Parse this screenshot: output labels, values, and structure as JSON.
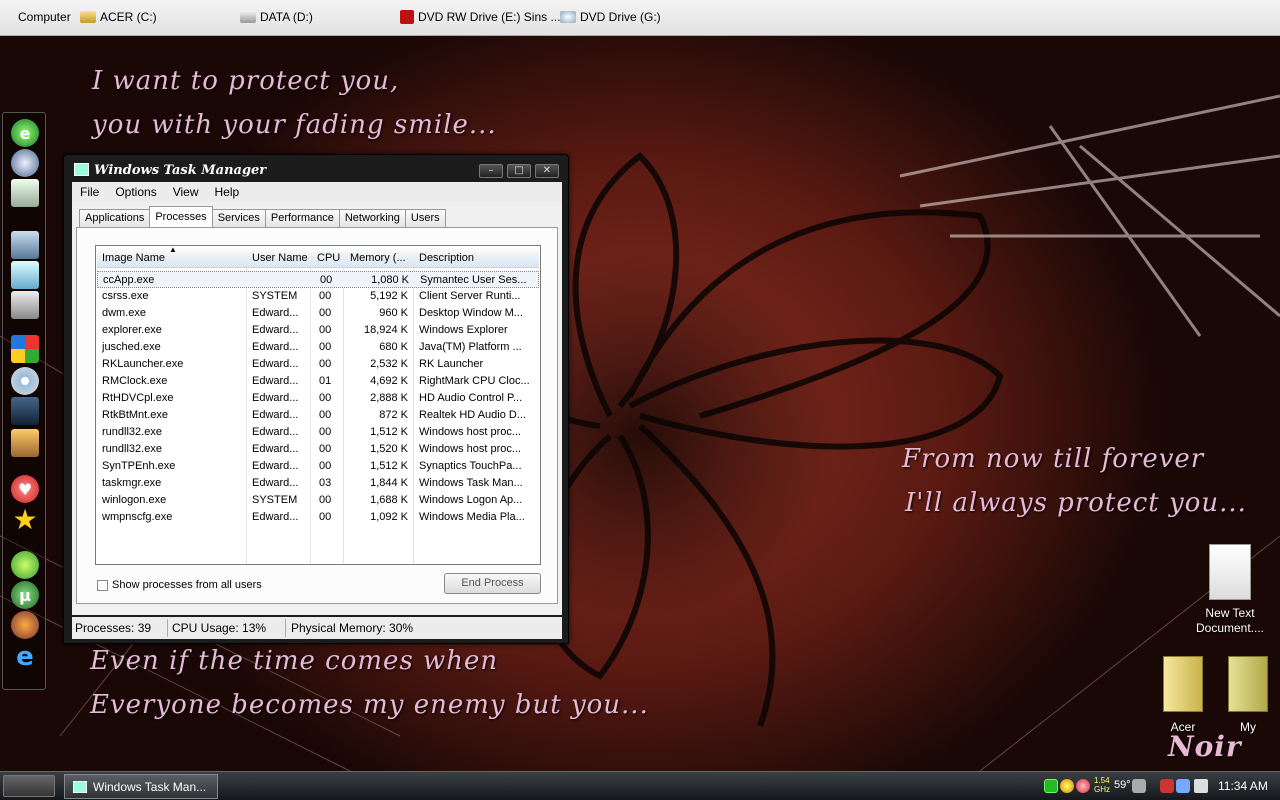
{
  "drives_bar": {
    "items": [
      {
        "label": "Computer",
        "icon": "computer-icon"
      },
      {
        "label": "ACER (C:)",
        "icon": "hard-drive-icon"
      },
      {
        "label": "DATA (D:)",
        "icon": "hard-drive-icon"
      },
      {
        "label": "DVD RW Drive (E:) Sins ...",
        "icon": "dvd-rw-icon"
      },
      {
        "label": "DVD Drive (G:)",
        "icon": "dvd-drive-icon"
      }
    ]
  },
  "wallpaper": {
    "poem_top": [
      "I want to protect you,",
      "you with your fading smile..."
    ],
    "poem_right": [
      "From now till forever",
      "I'll always protect you..."
    ],
    "poem_bottom": [
      "Even if the time comes when",
      "Everyone becomes my enemy but you..."
    ],
    "signature": "Noir"
  },
  "task_manager": {
    "title": "Windows Task Manager",
    "menu": [
      "File",
      "Options",
      "View",
      "Help"
    ],
    "tabs": [
      "Applications",
      "Processes",
      "Services",
      "Performance",
      "Networking",
      "Users"
    ],
    "active_tab": "Processes",
    "columns": [
      "Image Name",
      "User Name",
      "CPU",
      "Memory (...",
      "Description"
    ],
    "rows": [
      {
        "image": "ccApp.exe",
        "user": "",
        "cpu": "00",
        "mem": "1,080 K",
        "desc": "Symantec User Ses..."
      },
      {
        "image": "csrss.exe",
        "user": "SYSTEM",
        "cpu": "00",
        "mem": "5,192 K",
        "desc": "Client Server Runti..."
      },
      {
        "image": "dwm.exe",
        "user": "Edward...",
        "cpu": "00",
        "mem": "960 K",
        "desc": "Desktop Window M..."
      },
      {
        "image": "explorer.exe",
        "user": "Edward...",
        "cpu": "00",
        "mem": "18,924 K",
        "desc": "Windows Explorer"
      },
      {
        "image": "jusched.exe",
        "user": "Edward...",
        "cpu": "00",
        "mem": "680 K",
        "desc": "Java(TM) Platform ..."
      },
      {
        "image": "RKLauncher.exe",
        "user": "Edward...",
        "cpu": "00",
        "mem": "2,532 K",
        "desc": "RK Launcher"
      },
      {
        "image": "RMClock.exe",
        "user": "Edward...",
        "cpu": "01",
        "mem": "4,692 K",
        "desc": "RightMark CPU Cloc..."
      },
      {
        "image": "RtHDVCpl.exe",
        "user": "Edward...",
        "cpu": "00",
        "mem": "2,888 K",
        "desc": "HD Audio Control P..."
      },
      {
        "image": "RtkBtMnt.exe",
        "user": "Edward...",
        "cpu": "00",
        "mem": "872 K",
        "desc": "Realtek HD Audio D..."
      },
      {
        "image": "rundll32.exe",
        "user": "Edward...",
        "cpu": "00",
        "mem": "1,512 K",
        "desc": "Windows host proc..."
      },
      {
        "image": "rundll32.exe",
        "user": "Edward...",
        "cpu": "00",
        "mem": "1,520 K",
        "desc": "Windows host proc..."
      },
      {
        "image": "SynTPEnh.exe",
        "user": "Edward...",
        "cpu": "00",
        "mem": "1,512 K",
        "desc": "Synaptics TouchPa..."
      },
      {
        "image": "taskmgr.exe",
        "user": "Edward...",
        "cpu": "03",
        "mem": "1,844 K",
        "desc": "Windows Task Man..."
      },
      {
        "image": "winlogon.exe",
        "user": "SYSTEM",
        "cpu": "00",
        "mem": "1,688 K",
        "desc": "Windows Logon Ap..."
      },
      {
        "image": "wmpnscfg.exe",
        "user": "Edward...",
        "cpu": "00",
        "mem": "1,092 K",
        "desc": "Windows Media Pla..."
      }
    ],
    "show_all_label": "Show processes from all users",
    "show_all_checked": false,
    "end_process_label": "End Process",
    "status": {
      "processes": "Processes: 39",
      "cpu": "CPU Usage: 13%",
      "memory": "Physical Memory: 30%"
    }
  },
  "desktop_icons": [
    {
      "label": "New Text Document....",
      "icon": "text-document-icon"
    },
    {
      "label": "Acer",
      "icon": "folder-icon"
    },
    {
      "label": "My",
      "icon": "folder-icon"
    }
  ],
  "dock": {
    "icons": [
      "ie-green-icon",
      "globe-icon",
      "recycle-bin-icon",
      "calculator-icon",
      "notepad-icon",
      "tools-icon",
      "windows-icon",
      "cd-icon",
      "media-icon",
      "photo-icon",
      "heart-icon",
      "star-icon",
      "utorrent-green-icon",
      "utorrent-icon",
      "firefox-icon",
      "ie-icon"
    ]
  },
  "taskbar": {
    "task_label": "Windows Task Man...",
    "tray_text": "1.54 GHz",
    "temp": "59°",
    "clock": "11:34 AM"
  },
  "colors": {
    "poem": "#e7b9d6",
    "wallpaper": "#7a2a1e",
    "taskbar": "#1f2327"
  }
}
